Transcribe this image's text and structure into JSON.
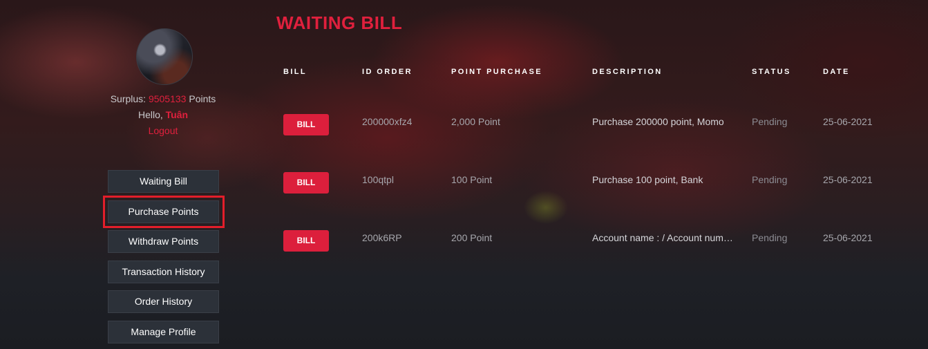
{
  "sidebar": {
    "surplus_label": "Surplus:",
    "surplus_value": "9505133",
    "surplus_unit": "Points",
    "hello_label": "Hello,",
    "username": "Tuân",
    "logout": "Logout",
    "menu": [
      {
        "label": "Waiting Bill"
      },
      {
        "label": "Purchase Points",
        "highlighted": true
      },
      {
        "label": "Withdraw Points"
      },
      {
        "label": "Transaction History"
      },
      {
        "label": "Order History"
      },
      {
        "label": "Manage Profile"
      }
    ]
  },
  "main": {
    "title": "WAITING BILL",
    "columns": [
      "BILL",
      "ID ORDER",
      "POINT PURCHASE",
      "DESCRIPTION",
      "STATUS",
      "DATE"
    ],
    "rows": [
      {
        "bill": "BILL",
        "id_order": "200000xfz4",
        "points": "2,000 Point",
        "description": "Purchase 200000 point, Momo",
        "status": "Pending",
        "date": "25-06-2021"
      },
      {
        "bill": "BILL",
        "id_order": "100qtpl",
        "points": "100 Point",
        "description": "Purchase 100 point, Bank",
        "status": "Pending",
        "date": "25-06-2021"
      },
      {
        "bill": "BILL",
        "id_order": "200k6RP",
        "points": "200 Point",
        "description": "Account name : / Account number :",
        "status": "Pending",
        "date": "25-06-2021"
      }
    ]
  },
  "colors": {
    "accent": "#e0203d",
    "highlight_box": "#e31e2a",
    "button_bg": "#2c3139"
  }
}
